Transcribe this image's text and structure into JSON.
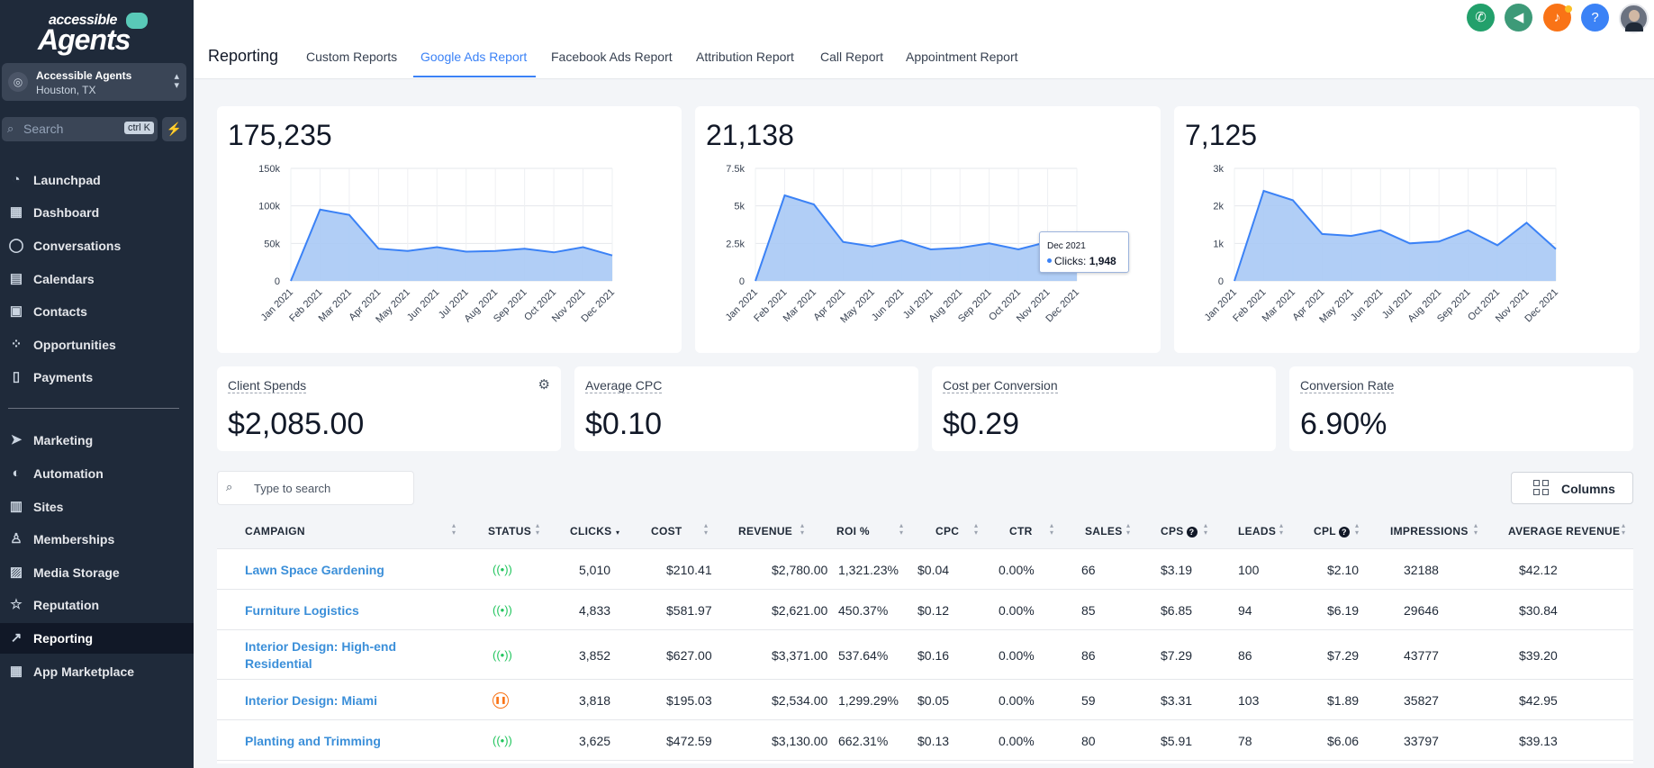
{
  "brand": {
    "line1": "accessible",
    "line2": "Agents"
  },
  "account": {
    "name": "Accessible Agents",
    "location": "Houston, TX"
  },
  "sidebar_search": {
    "placeholder": "Search",
    "shortcut": "ctrl K"
  },
  "nav": [
    {
      "label": "Launchpad",
      "icon": "rocket-icon"
    },
    {
      "label": "Dashboard",
      "icon": "grid-icon"
    },
    {
      "label": "Conversations",
      "icon": "chat-icon"
    },
    {
      "label": "Calendars",
      "icon": "calendar-icon"
    },
    {
      "label": "Contacts",
      "icon": "contacts-icon"
    },
    {
      "label": "Opportunities",
      "icon": "network-icon"
    },
    {
      "label": "Payments",
      "icon": "payments-icon"
    },
    {
      "label": "Marketing",
      "icon": "send-icon"
    },
    {
      "label": "Automation",
      "icon": "automation-icon"
    },
    {
      "label": "Sites",
      "icon": "sites-icon"
    },
    {
      "label": "Memberships",
      "icon": "membership-icon"
    },
    {
      "label": "Media Storage",
      "icon": "image-icon"
    },
    {
      "label": "Reputation",
      "icon": "star-icon"
    },
    {
      "label": "Reporting",
      "icon": "trend-icon",
      "active": true
    },
    {
      "label": "App Marketplace",
      "icon": "apps-icon"
    }
  ],
  "header": {
    "title": "Reporting",
    "tabs": [
      "Custom Reports",
      "Google Ads Report",
      "Facebook Ads Report",
      "Attribution Report",
      "Call Report",
      "Appointment Report"
    ],
    "active_tab": "Google Ads Report"
  },
  "top_icons": [
    {
      "name": "phone-icon",
      "color": "#22a06b"
    },
    {
      "name": "megaphone-icon",
      "color": "#3d9a78"
    },
    {
      "name": "bell-icon",
      "color": "#f97316"
    },
    {
      "name": "help-icon",
      "color": "#3b82f6",
      "glyph": "?"
    }
  ],
  "chart_data": [
    {
      "type": "area",
      "total": "175,235",
      "x": [
        "Jan 2021",
        "Feb 2021",
        "Mar 2021",
        "Apr 2021",
        "May 2021",
        "Jun 2021",
        "Jul 2021",
        "Aug 2021",
        "Sep 2021",
        "Oct 2021",
        "Nov 2021",
        "Dec 2021"
      ],
      "values": [
        0,
        95000,
        88000,
        43000,
        40000,
        45000,
        39000,
        40000,
        43000,
        38000,
        45000,
        34000
      ],
      "ylim": [
        0,
        150000
      ],
      "yticks": [
        {
          "v": 0,
          "l": "0"
        },
        {
          "v": 50000,
          "l": "50k"
        },
        {
          "v": 100000,
          "l": "100k"
        },
        {
          "v": 150000,
          "l": "150k"
        }
      ]
    },
    {
      "type": "area",
      "total": "21,138",
      "x": [
        "Jan 2021",
        "Feb 2021",
        "Mar 2021",
        "Apr 2021",
        "May 2021",
        "Jun 2021",
        "Jul 2021",
        "Aug 2021",
        "Sep 2021",
        "Oct 2021",
        "Nov 2021",
        "Dec 2021"
      ],
      "values": [
        0,
        5700,
        5100,
        2600,
        2300,
        2700,
        2100,
        2200,
        2500,
        2100,
        2600,
        1948
      ],
      "ylim": [
        0,
        7500
      ],
      "yticks": [
        {
          "v": 0,
          "l": "0"
        },
        {
          "v": 2500,
          "l": "2.5k"
        },
        {
          "v": 5000,
          "l": "5k"
        },
        {
          "v": 7500,
          "l": "7.5k"
        }
      ],
      "tooltip": {
        "date": "Dec 2021",
        "label": "Clicks:",
        "value": "1,948"
      }
    },
    {
      "type": "area",
      "total": "7,125",
      "x": [
        "Jan 2021",
        "Feb 2021",
        "Mar 2021",
        "Apr 2021",
        "May 2021",
        "Jun 2021",
        "Jul 2021",
        "Aug 2021",
        "Sep 2021",
        "Oct 2021",
        "Nov 2021",
        "Dec 2021"
      ],
      "values": [
        0,
        2400,
        2150,
        1250,
        1200,
        1350,
        1000,
        1050,
        1350,
        950,
        1550,
        850
      ],
      "ylim": [
        0,
        3000
      ],
      "yticks": [
        {
          "v": 0,
          "l": "0"
        },
        {
          "v": 1000,
          "l": "1k"
        },
        {
          "v": 2000,
          "l": "2k"
        },
        {
          "v": 3000,
          "l": "3k"
        }
      ]
    }
  ],
  "kpis": [
    {
      "label": "Client Spends",
      "value": "$2,085.00"
    },
    {
      "label": "Average CPC",
      "value": "$0.10"
    },
    {
      "label": "Cost per Conversion",
      "value": "$0.29"
    },
    {
      "label": "Conversion Rate",
      "value": "6.90%"
    }
  ],
  "table": {
    "search_placeholder": "Type to search",
    "columns_button": "Columns",
    "headers": [
      "CAMPAIGN",
      "STATUS",
      "CLICKS",
      "COST",
      "REVENUE",
      "ROI %",
      "CPC",
      "CTR",
      "SALES",
      "CPS",
      "LEADS",
      "CPL",
      "IMPRESSIONS",
      "AVERAGE REVENUE"
    ],
    "rows": [
      {
        "campaign": "Lawn Space Gardening",
        "status": "active",
        "cells": [
          "5,010",
          "$210.41",
          "$2,780.00",
          "1,321.23%",
          "$0.04",
          "0.00%",
          "66",
          "$3.19",
          "100",
          "$2.10",
          "32188",
          "$42.12"
        ]
      },
      {
        "campaign": "Furniture Logistics",
        "status": "active",
        "cells": [
          "4,833",
          "$581.97",
          "$2,621.00",
          "450.37%",
          "$0.12",
          "0.00%",
          "85",
          "$6.85",
          "94",
          "$6.19",
          "29646",
          "$30.84"
        ]
      },
      {
        "campaign": "Interior Design: High-end Residential",
        "status": "active",
        "cells": [
          "3,852",
          "$627.00",
          "$3,371.00",
          "537.64%",
          "$0.16",
          "0.00%",
          "86",
          "$7.29",
          "86",
          "$7.29",
          "43777",
          "$39.20"
        ]
      },
      {
        "campaign": "Interior Design: Miami",
        "status": "paused",
        "cells": [
          "3,818",
          "$195.03",
          "$2,534.00",
          "1,299.29%",
          "$0.05",
          "0.00%",
          "59",
          "$3.31",
          "103",
          "$1.89",
          "35827",
          "$42.95"
        ]
      },
      {
        "campaign": "Planting and Trimming",
        "status": "active",
        "cells": [
          "3,625",
          "$472.59",
          "$3,130.00",
          "662.31%",
          "$0.13",
          "0.00%",
          "80",
          "$5.91",
          "78",
          "$6.06",
          "33797",
          "$39.13"
        ]
      }
    ]
  }
}
